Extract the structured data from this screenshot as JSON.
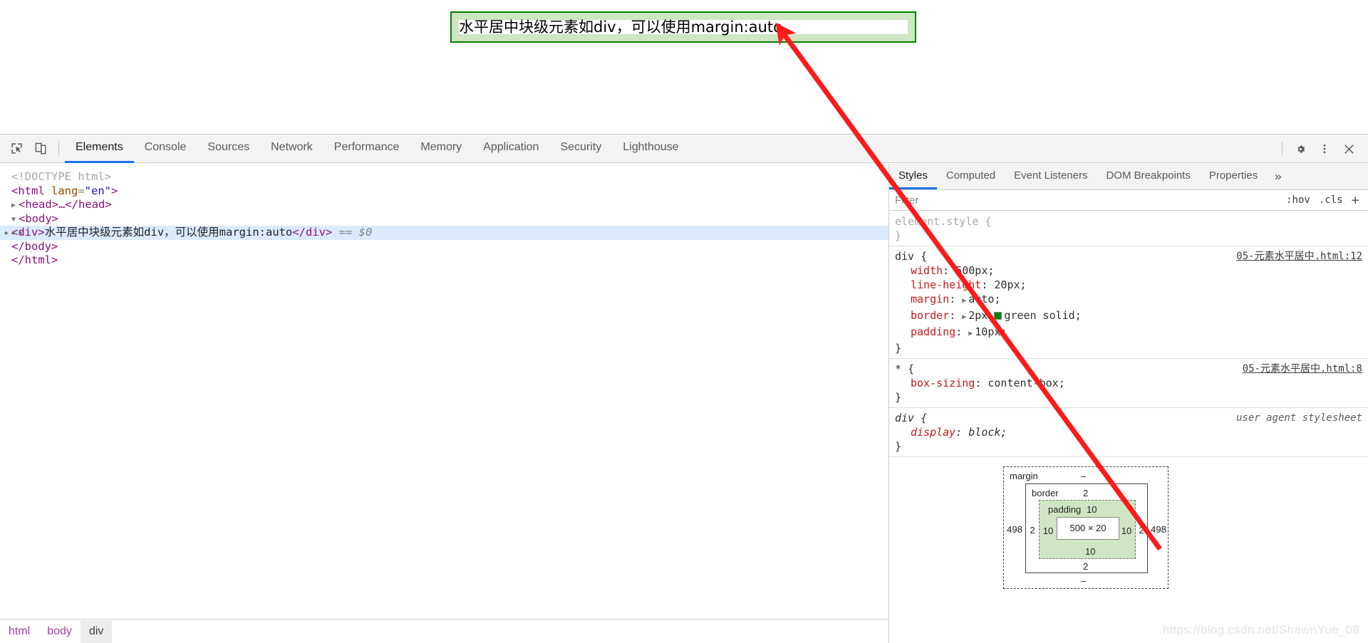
{
  "page": {
    "div_text": "水平居中块级元素如div，可以使用margin:auto"
  },
  "devtools": {
    "toolbar": {
      "inspect_icon": "inspect-element-icon",
      "device_icon": "device-toolbar-icon",
      "settings_icon": "gear-icon",
      "more_icon": "kebab-menu-icon",
      "close_icon": "close-icon",
      "tabs": [
        {
          "label": "Elements",
          "active": true
        },
        {
          "label": "Console",
          "active": false
        },
        {
          "label": "Sources",
          "active": false
        },
        {
          "label": "Network",
          "active": false
        },
        {
          "label": "Performance",
          "active": false
        },
        {
          "label": "Memory",
          "active": false
        },
        {
          "label": "Application",
          "active": false
        },
        {
          "label": "Security",
          "active": false
        },
        {
          "label": "Lighthouse",
          "active": false
        }
      ]
    },
    "dom": {
      "l0": "<!DOCTYPE html>",
      "l1_tag_open": "<html ",
      "l1_attr": "lang",
      "l1_eq": "=",
      "l1_val": "\"en\"",
      "l1_close": ">",
      "l2": "<head>…</head>",
      "l3": "<body>",
      "l4_open": "<div>",
      "l4_text": "水平居中块级元素如div，可以使用margin:auto",
      "l4_close": "</div>",
      "l4_eq": "== ",
      "l4_dollar": "$0",
      "l5": "</body>",
      "l6": "</html>",
      "ellipsis": "•••"
    },
    "breadcrumb": [
      {
        "label": "html",
        "active": false
      },
      {
        "label": "body",
        "active": false
      },
      {
        "label": "div",
        "active": true
      }
    ],
    "styles": {
      "tabs": [
        {
          "label": "Styles",
          "active": true
        },
        {
          "label": "Computed",
          "active": false
        },
        {
          "label": "Event Listeners",
          "active": false
        },
        {
          "label": "DOM Breakpoints",
          "active": false
        },
        {
          "label": "Properties",
          "active": false
        }
      ],
      "more_label": "»",
      "filter_placeholder": "Filter",
      "filter_value": "",
      "hov_label": ":hov",
      "cls_label": ".cls",
      "plus_label": "+",
      "rules": {
        "element_style": {
          "selector": "element.style {",
          "close": "}"
        },
        "div_rule": {
          "selector": "div {",
          "source": "05-元素水平居中.html:12",
          "close": "}",
          "declarations": [
            {
              "prop": "width",
              "value": "500px;",
              "expandable": false
            },
            {
              "prop": "line-height",
              "value": "20px;",
              "expandable": false
            },
            {
              "prop": "margin",
              "value": "auto;",
              "expandable": true
            },
            {
              "prop": "border",
              "value": "2px",
              "value2": "green solid;",
              "expandable": true,
              "swatch": "#008000"
            },
            {
              "prop": "padding",
              "value": "10px;",
              "expandable": true
            }
          ]
        },
        "star_rule": {
          "selector": "* {",
          "source": "05-元素水平居中.html:8",
          "close": "}",
          "declarations": [
            {
              "prop": "box-sizing",
              "value": "content-box;",
              "expandable": false
            }
          ]
        },
        "ua_rule": {
          "selector": "div {",
          "source": "user agent stylesheet",
          "close": "}",
          "declarations": [
            {
              "prop": "display",
              "value": "block;",
              "expandable": false
            }
          ]
        }
      },
      "box_model": {
        "margin_label": "margin",
        "border_label": "border",
        "padding_label": "padding",
        "content_label": "500 × 20",
        "margin_top": "–",
        "margin_right": "498",
        "margin_bottom": "–",
        "margin_left": "498",
        "border_top": "2",
        "border_right": "2",
        "border_bottom": "2",
        "border_left": "2",
        "padding_top": "10",
        "padding_right": "10",
        "padding_bottom": "10",
        "padding_left": "10"
      }
    }
  },
  "watermark": "https://blog.csdn.net/ShawnYue_08",
  "colors": {
    "accent": "#1a73e8",
    "border_green": "#008000",
    "padding_green": "#cfe5c3",
    "annotation_red": "#fc1b1b",
    "selection_blue": "#dbeaff"
  }
}
